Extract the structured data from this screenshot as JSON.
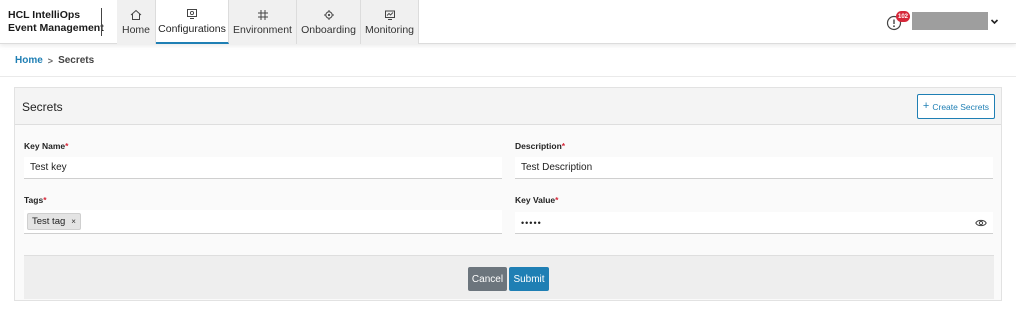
{
  "app": {
    "title_line1": "HCL IntelliOps",
    "title_line2": "Event Management"
  },
  "nav": {
    "items": [
      {
        "label": "Home",
        "icon": "home-icon"
      },
      {
        "label": "Configurations",
        "icon": "configurations-icon",
        "active": true
      },
      {
        "label": "Environment",
        "icon": "environment-icon"
      },
      {
        "label": "Onboarding",
        "icon": "onboarding-icon"
      },
      {
        "label": "Monitoring",
        "icon": "monitoring-icon"
      }
    ]
  },
  "header": {
    "alert_count": "102"
  },
  "breadcrumb": {
    "home": "Home",
    "separator": ">",
    "current": "Secrets"
  },
  "panel": {
    "title": "Secrets",
    "create_button": "Create Secrets",
    "create_icon": "+"
  },
  "form": {
    "key_name": {
      "label": "Key Name",
      "required": "*",
      "value": "Test key"
    },
    "description": {
      "label": "Description",
      "required": "*",
      "value": "Test Description"
    },
    "tags": {
      "label": "Tags",
      "required": "*",
      "items": [
        "Test tag"
      ],
      "remove": "×"
    },
    "key_value": {
      "label": "Key Value",
      "required": "*",
      "value": "•••••"
    }
  },
  "actions": {
    "cancel": "Cancel",
    "submit": "Submit"
  },
  "colors": {
    "accent": "#1f7fb4",
    "badge": "#d6283a",
    "cancel": "#6c757d"
  }
}
